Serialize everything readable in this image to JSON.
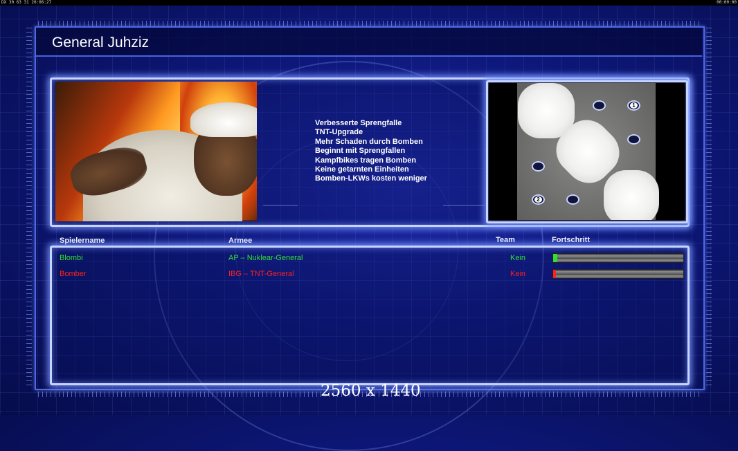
{
  "topbar": {
    "left_text": "DX 30 63 31 20:06:27",
    "right_text": "00:00:00"
  },
  "title": "General Juhziz",
  "general": {
    "portrait": "general-juhziz-portrait",
    "bonuses": [
      "Verbesserte Sprengfalle",
      "TNT-Upgrade",
      "Mehr Schaden durch Bomben",
      "Beginnt mit Sprengfallen",
      "Kampfbikes tragen Bomben",
      "Keine getarnten Einheiten",
      "Bomben-LKWs kosten weniger"
    ]
  },
  "map": {
    "start_labels": [
      "1",
      "2"
    ]
  },
  "table": {
    "headers": {
      "player": "Spielername",
      "army": "Armee",
      "team": "Team",
      "progress": "Fortschritt"
    },
    "rows": [
      {
        "player": "Blombi",
        "army": "AP – Nuklear-General",
        "team": "Kein",
        "progress": 0.03,
        "color": "#30e030"
      },
      {
        "player": "Bomber",
        "army": "IBG – TNT-General",
        "team": "Kein",
        "progress": 0.02,
        "color": "#ff2020"
      }
    ]
  },
  "resolution_label": "2560 x 1440",
  "colors": {
    "background": "#0d1778",
    "panel_border": "#c8d4ff",
    "player1": "#30e030",
    "player2": "#ff2020"
  }
}
